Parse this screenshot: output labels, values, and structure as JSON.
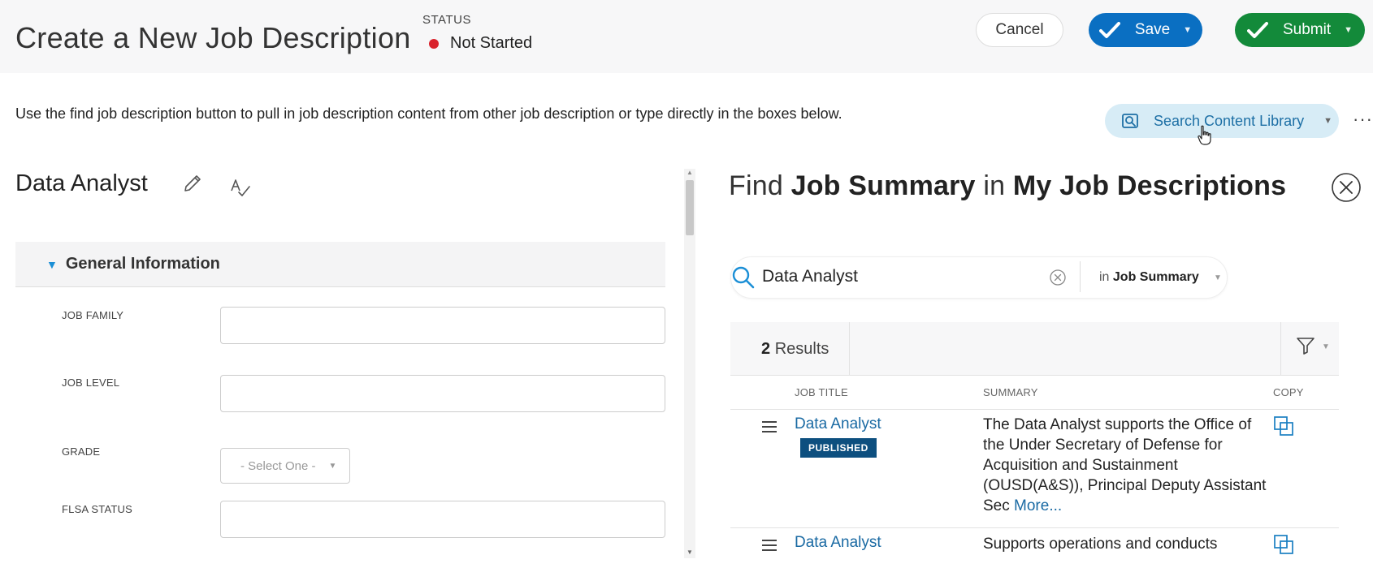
{
  "header": {
    "title": "Create a New Job Description",
    "status_label": "STATUS",
    "status_value": "Not Started",
    "cancel_label": "Cancel",
    "save_label": "Save",
    "submit_label": "Submit"
  },
  "instructions": {
    "text": "Use the find job description button to pull in job description content from other job description or type directly in the boxes below.",
    "search_library_label": "Search Content Library",
    "more_label": "···"
  },
  "left_panel": {
    "job_title": "Data Analyst",
    "section_title": "General Information",
    "fields": [
      {
        "label": "JOB FAMILY",
        "value": ""
      },
      {
        "label": "JOB LEVEL",
        "value": ""
      },
      {
        "label": "GRADE",
        "value": "- Select One -"
      },
      {
        "label": "FLSA STATUS",
        "value": ""
      }
    ]
  },
  "right_panel": {
    "title_prefix": "Find",
    "title_section": "Job Summary",
    "title_middle": "in",
    "title_source": "My Job Descriptions",
    "search_value": "Data Analyst",
    "scope_prefix": "in",
    "scope_value": "Job Summary",
    "results_count": "2",
    "results_label": "Results",
    "columns": [
      "JOB TITLE",
      "SUMMARY",
      "COPY"
    ],
    "rows": [
      {
        "job_title": "Data Analyst",
        "badge": "PUBLISHED",
        "summary": "The Data Analyst supports the Office of the Under Secretary of Defense for Acquisition and Sustainment (OUSD(A&S)), Principal Deputy Assistant Sec",
        "more": "More..."
      },
      {
        "job_title": "Data Analyst",
        "summary": "Supports operations and conducts"
      }
    ]
  },
  "colors": {
    "save": "#0a6fc2",
    "submit": "#138a3a",
    "status_dot": "#d9232d",
    "link": "#1a6aa3",
    "badge": "#0d4f7f",
    "search_library_bg": "#d7ecf6"
  },
  "icons": {
    "check": "check-icon",
    "pencil": "pencil-icon",
    "spellcheck": "spellcheck-icon",
    "close": "close-icon",
    "search": "search-icon",
    "clear": "clear-icon",
    "filter": "filter-icon",
    "drag": "drag-handle-icon",
    "copy": "copy-icon",
    "library": "search-library-icon"
  }
}
